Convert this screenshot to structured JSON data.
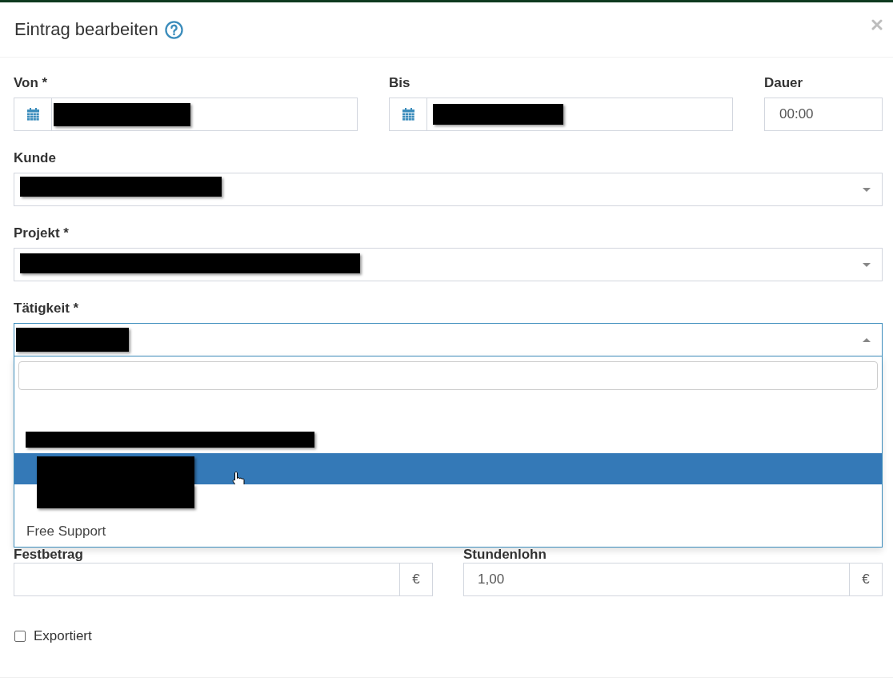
{
  "dialog": {
    "title": "Eintrag bearbeiten"
  },
  "time_row": [
    {
      "kind": "date",
      "label": "Von *",
      "redacted": true
    },
    {
      "kind": "date",
      "label": "Bis",
      "redacted": true
    },
    {
      "kind": "text",
      "label": "Dauer",
      "value": "00:00"
    }
  ],
  "selects": [
    {
      "label": "Kunde",
      "redacted": true,
      "open": false
    },
    {
      "label": "Projekt *",
      "redacted": true,
      "open": false
    },
    {
      "label": "Tätigkeit *",
      "redacted": true,
      "open": true,
      "options": [
        {
          "redacted": true,
          "selected": false,
          "children": [
            {
              "redacted": true,
              "selected": true
            },
            {
              "redacted": true,
              "selected": false
            }
          ]
        },
        {
          "label": "Free Support",
          "selected": false
        }
      ]
    }
  ],
  "amounts": [
    {
      "label": "Festbetrag",
      "unit": "€"
    },
    {
      "label": "Stundenlohn",
      "value": "1,00",
      "unit": "€"
    }
  ],
  "exported": {
    "label": "Exportiert",
    "checked": false
  }
}
